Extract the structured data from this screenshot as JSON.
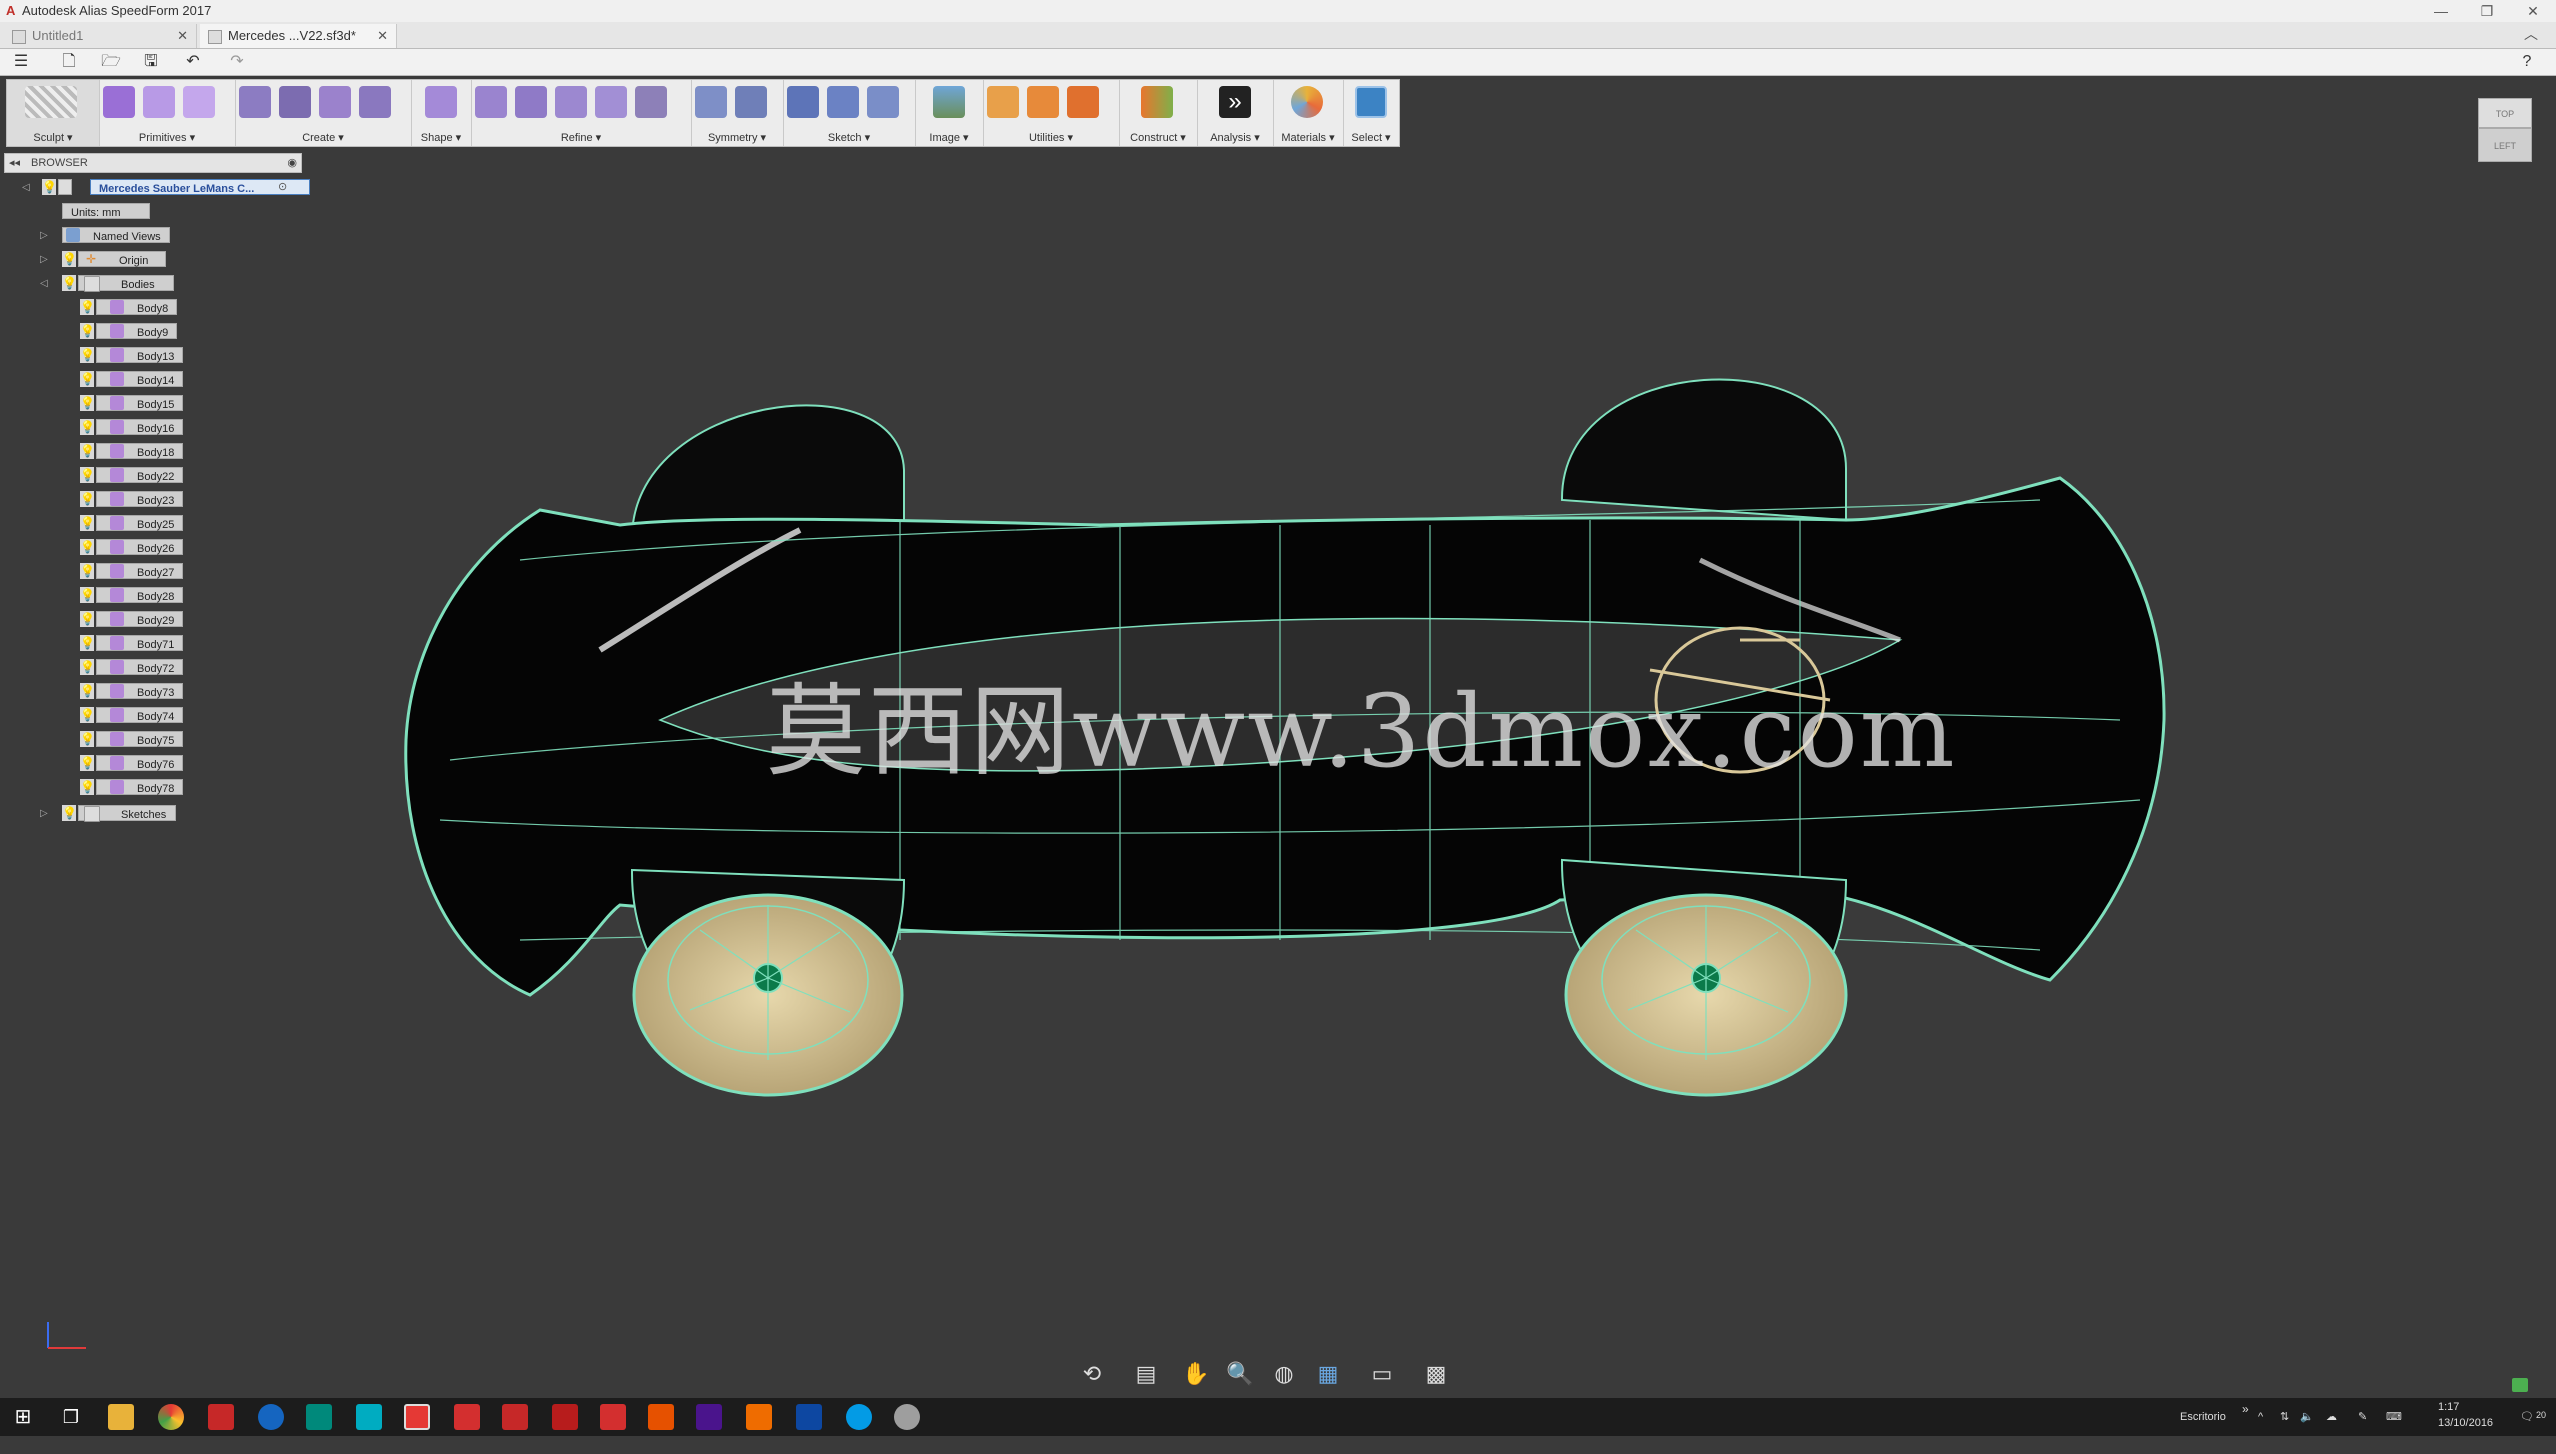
{
  "window": {
    "title": "Autodesk Alias SpeedForm 2017"
  },
  "tabs": [
    {
      "label": "Untitled1",
      "close": "✕",
      "active": false
    },
    {
      "label": "Mercedes ...V22.sf3d*",
      "close": "✕",
      "active": true
    }
  ],
  "toolbar": {
    "groups": [
      {
        "label": "Sculpt ▾"
      },
      {
        "label": "Primitives ▾"
      },
      {
        "label": "Create ▾"
      },
      {
        "label": "Shape ▾"
      },
      {
        "label": "Refine ▾"
      },
      {
        "label": "Symmetry ▾"
      },
      {
        "label": "Sketch ▾"
      },
      {
        "label": "Image ▾"
      },
      {
        "label": "Utilities ▾"
      },
      {
        "label": "Construct ▾"
      },
      {
        "label": "Analysis ▾"
      },
      {
        "label": "Materials ▾"
      },
      {
        "label": "Select ▾"
      }
    ]
  },
  "browser": {
    "title": "BROWSER",
    "root": "Mercedes Sauber LeMans C...",
    "units": "Units: mm",
    "named_views": "Named Views",
    "origin": "Origin",
    "bodies": "Bodies",
    "body_items": [
      "Body8",
      "Body9",
      "Body13",
      "Body14",
      "Body15",
      "Body16",
      "Body18",
      "Body22",
      "Body23",
      "Body25",
      "Body26",
      "Body27",
      "Body28",
      "Body29",
      "Body71",
      "Body72",
      "Body73",
      "Body74",
      "Body75",
      "Body76",
      "Body78"
    ],
    "sketches": "Sketches"
  },
  "viewcube": {
    "top": "TOP",
    "left": "LEFT"
  },
  "watermark": "莫西网www.3dmox.com",
  "taskbar": {
    "language": "Escritorio",
    "time": "1:17",
    "date": "13/10/2016",
    "notifications": "20"
  },
  "colors": {
    "accent": "#3c83c4",
    "wire": "#7fe0bd",
    "wheel": "#c9b98a"
  }
}
